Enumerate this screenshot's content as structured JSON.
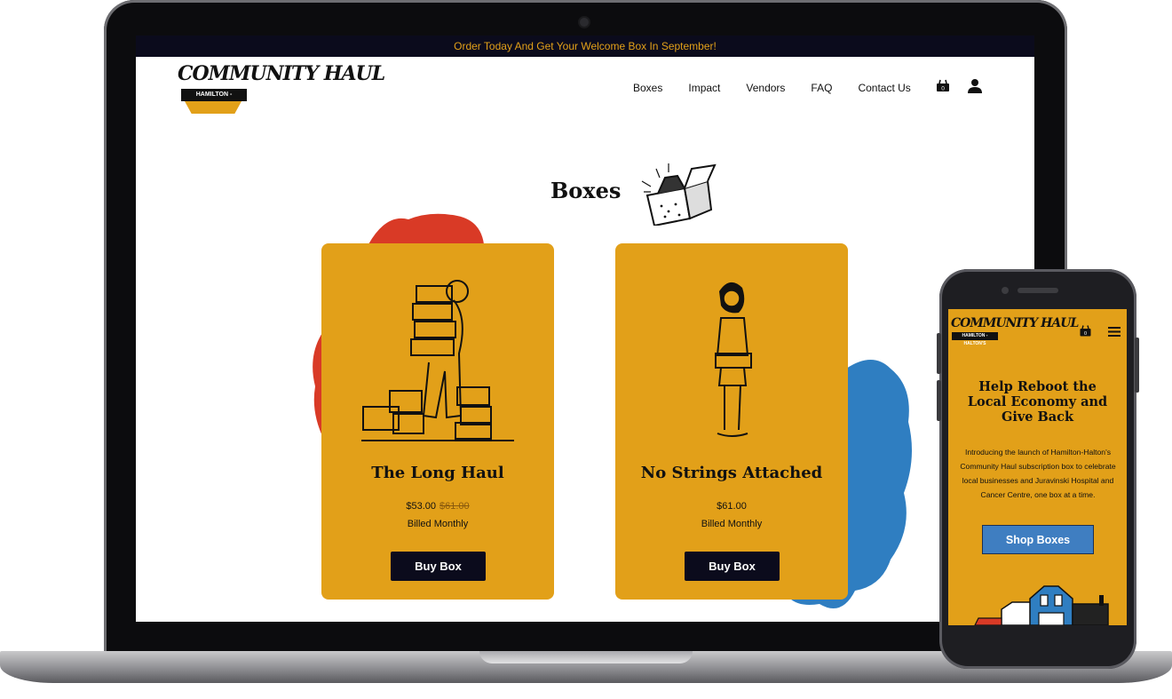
{
  "announcement": "Order Today And Get Your Welcome Box In September!",
  "brand": {
    "name": "COMMUNITY HAUL",
    "ribbon": "HAMILTON - HALTON'S"
  },
  "nav": {
    "items": [
      "Boxes",
      "Impact",
      "Vendors",
      "FAQ",
      "Contact Us"
    ],
    "cart_count": "0"
  },
  "page": {
    "title": "Boxes"
  },
  "cards": [
    {
      "title": "The Long Haul",
      "price": "$53.00",
      "old_price": "$61.00",
      "billing": "Billed Monthly",
      "button": "Buy Box"
    },
    {
      "title": "No Strings Attached",
      "price": "$61.00",
      "old_price": "",
      "billing": "Billed Monthly",
      "button": "Buy Box"
    }
  ],
  "mobile": {
    "cart_count": "0",
    "heading": "Help Reboot the Local Economy and Give Back",
    "body": "Introducing the launch of Hamilton-Halton's Community Haul subscription box to celebrate local businesses and Juravinski Hospital and Cancer Centre, one box at a time.",
    "button": "Shop Boxes"
  },
  "colors": {
    "accent": "#e2a019",
    "dark": "#0b0b1c",
    "blob_red": "#d93a26",
    "blob_blue": "#2f7ec1",
    "mobile_button": "#3f7ec1"
  },
  "icons": [
    "cart-icon",
    "user-icon",
    "menu-icon",
    "camera-icon"
  ]
}
